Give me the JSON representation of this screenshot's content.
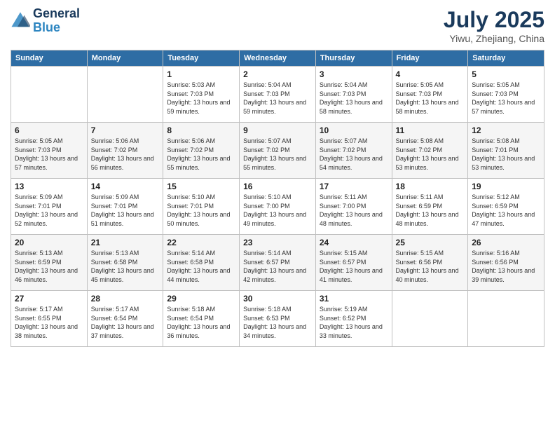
{
  "header": {
    "logo_line1": "General",
    "logo_line2": "Blue",
    "month_year": "July 2025",
    "location": "Yiwu, Zhejiang, China"
  },
  "days_of_week": [
    "Sunday",
    "Monday",
    "Tuesday",
    "Wednesday",
    "Thursday",
    "Friday",
    "Saturday"
  ],
  "weeks": [
    [
      {
        "day": "",
        "info": ""
      },
      {
        "day": "",
        "info": ""
      },
      {
        "day": "1",
        "info": "Sunrise: 5:03 AM\nSunset: 7:03 PM\nDaylight: 13 hours and 59 minutes."
      },
      {
        "day": "2",
        "info": "Sunrise: 5:04 AM\nSunset: 7:03 PM\nDaylight: 13 hours and 59 minutes."
      },
      {
        "day": "3",
        "info": "Sunrise: 5:04 AM\nSunset: 7:03 PM\nDaylight: 13 hours and 58 minutes."
      },
      {
        "day": "4",
        "info": "Sunrise: 5:05 AM\nSunset: 7:03 PM\nDaylight: 13 hours and 58 minutes."
      },
      {
        "day": "5",
        "info": "Sunrise: 5:05 AM\nSunset: 7:03 PM\nDaylight: 13 hours and 57 minutes."
      }
    ],
    [
      {
        "day": "6",
        "info": "Sunrise: 5:05 AM\nSunset: 7:03 PM\nDaylight: 13 hours and 57 minutes."
      },
      {
        "day": "7",
        "info": "Sunrise: 5:06 AM\nSunset: 7:02 PM\nDaylight: 13 hours and 56 minutes."
      },
      {
        "day": "8",
        "info": "Sunrise: 5:06 AM\nSunset: 7:02 PM\nDaylight: 13 hours and 55 minutes."
      },
      {
        "day": "9",
        "info": "Sunrise: 5:07 AM\nSunset: 7:02 PM\nDaylight: 13 hours and 55 minutes."
      },
      {
        "day": "10",
        "info": "Sunrise: 5:07 AM\nSunset: 7:02 PM\nDaylight: 13 hours and 54 minutes."
      },
      {
        "day": "11",
        "info": "Sunrise: 5:08 AM\nSunset: 7:02 PM\nDaylight: 13 hours and 53 minutes."
      },
      {
        "day": "12",
        "info": "Sunrise: 5:08 AM\nSunset: 7:01 PM\nDaylight: 13 hours and 53 minutes."
      }
    ],
    [
      {
        "day": "13",
        "info": "Sunrise: 5:09 AM\nSunset: 7:01 PM\nDaylight: 13 hours and 52 minutes."
      },
      {
        "day": "14",
        "info": "Sunrise: 5:09 AM\nSunset: 7:01 PM\nDaylight: 13 hours and 51 minutes."
      },
      {
        "day": "15",
        "info": "Sunrise: 5:10 AM\nSunset: 7:01 PM\nDaylight: 13 hours and 50 minutes."
      },
      {
        "day": "16",
        "info": "Sunrise: 5:10 AM\nSunset: 7:00 PM\nDaylight: 13 hours and 49 minutes."
      },
      {
        "day": "17",
        "info": "Sunrise: 5:11 AM\nSunset: 7:00 PM\nDaylight: 13 hours and 48 minutes."
      },
      {
        "day": "18",
        "info": "Sunrise: 5:11 AM\nSunset: 6:59 PM\nDaylight: 13 hours and 48 minutes."
      },
      {
        "day": "19",
        "info": "Sunrise: 5:12 AM\nSunset: 6:59 PM\nDaylight: 13 hours and 47 minutes."
      }
    ],
    [
      {
        "day": "20",
        "info": "Sunrise: 5:13 AM\nSunset: 6:59 PM\nDaylight: 13 hours and 46 minutes."
      },
      {
        "day": "21",
        "info": "Sunrise: 5:13 AM\nSunset: 6:58 PM\nDaylight: 13 hours and 45 minutes."
      },
      {
        "day": "22",
        "info": "Sunrise: 5:14 AM\nSunset: 6:58 PM\nDaylight: 13 hours and 44 minutes."
      },
      {
        "day": "23",
        "info": "Sunrise: 5:14 AM\nSunset: 6:57 PM\nDaylight: 13 hours and 42 minutes."
      },
      {
        "day": "24",
        "info": "Sunrise: 5:15 AM\nSunset: 6:57 PM\nDaylight: 13 hours and 41 minutes."
      },
      {
        "day": "25",
        "info": "Sunrise: 5:15 AM\nSunset: 6:56 PM\nDaylight: 13 hours and 40 minutes."
      },
      {
        "day": "26",
        "info": "Sunrise: 5:16 AM\nSunset: 6:56 PM\nDaylight: 13 hours and 39 minutes."
      }
    ],
    [
      {
        "day": "27",
        "info": "Sunrise: 5:17 AM\nSunset: 6:55 PM\nDaylight: 13 hours and 38 minutes."
      },
      {
        "day": "28",
        "info": "Sunrise: 5:17 AM\nSunset: 6:54 PM\nDaylight: 13 hours and 37 minutes."
      },
      {
        "day": "29",
        "info": "Sunrise: 5:18 AM\nSunset: 6:54 PM\nDaylight: 13 hours and 36 minutes."
      },
      {
        "day": "30",
        "info": "Sunrise: 5:18 AM\nSunset: 6:53 PM\nDaylight: 13 hours and 34 minutes."
      },
      {
        "day": "31",
        "info": "Sunrise: 5:19 AM\nSunset: 6:52 PM\nDaylight: 13 hours and 33 minutes."
      },
      {
        "day": "",
        "info": ""
      },
      {
        "day": "",
        "info": ""
      }
    ]
  ]
}
